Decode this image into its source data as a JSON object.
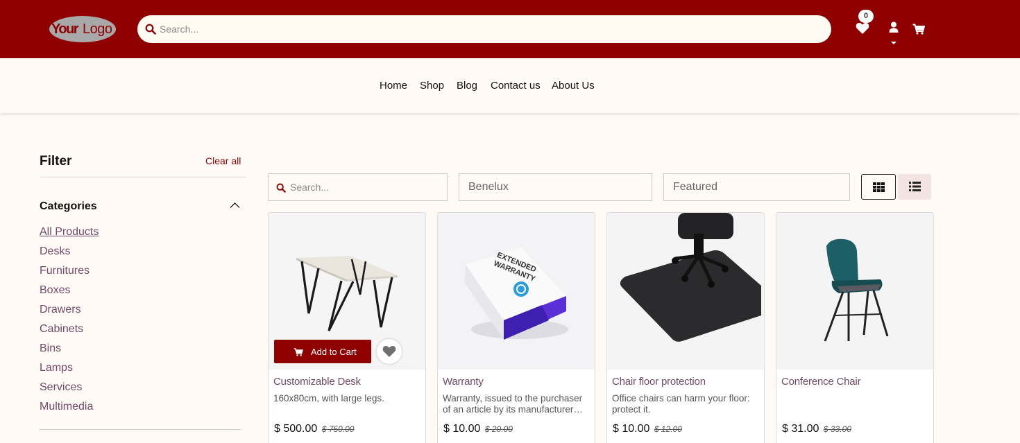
{
  "header": {
    "logo_text": "YourLogo",
    "search_placeholder": "Search...",
    "wishlist_count": "0",
    "brand_color": "#8f0000"
  },
  "nav": {
    "items": [
      "Home",
      "Shop",
      "Blog",
      "Contact us",
      "About Us"
    ]
  },
  "filter": {
    "title": "Filter",
    "clear_label": "Clear all",
    "categories_title": "Categories",
    "categories": [
      "All Products",
      "Desks",
      "Furnitures",
      "Boxes",
      "Drawers",
      "Cabinets",
      "Bins",
      "Lamps",
      "Services",
      "Multimedia"
    ],
    "active_category": "All Products"
  },
  "toolbar": {
    "search_placeholder": "Search...",
    "pricelist": "Benelux",
    "sort": "Featured",
    "view_mode": "grid"
  },
  "products": [
    {
      "name": "Customizable Desk",
      "description": "160x80cm, with large legs.",
      "price": "$ 500.00",
      "old_price": "$ 750.00",
      "add_to_cart_label": "Add to Cart",
      "image_icon": "desk-image"
    },
    {
      "name": "Warranty",
      "description": "Warranty, issued to the purchaser of an article by its manufacturer…",
      "price": "$ 10.00",
      "old_price": "$ 20.00",
      "image_icon": "warranty-box-image",
      "image_text": [
        "EXTENDED",
        "WARRANTY"
      ]
    },
    {
      "name": "Chair floor protection",
      "description": "Office chairs can harm your floor: protect it.",
      "price": "$ 10.00",
      "old_price": "$ 12.00",
      "image_icon": "floor-mat-image"
    },
    {
      "name": "Conference Chair",
      "description": "",
      "price": "$ 31.00",
      "old_price": "$ 33.00",
      "image_icon": "chair-image"
    }
  ]
}
